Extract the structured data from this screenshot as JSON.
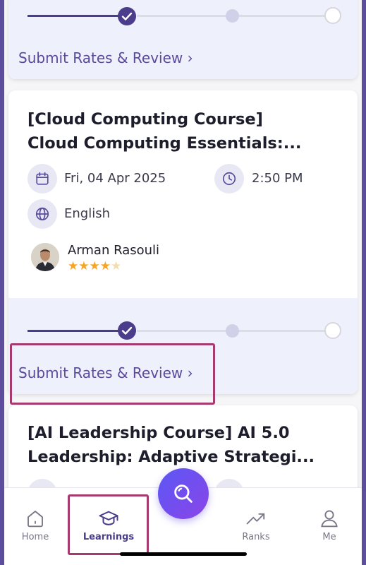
{
  "top_card": {
    "review_link": "Submit Rates & Review"
  },
  "course_card": {
    "title_line1": "[Cloud Computing Course]",
    "title_line2": "Cloud Computing Essentials:...",
    "date": "Fri, 04 Apr 2025",
    "time": "2:50 PM",
    "language": "English",
    "instructor": {
      "name": "Arman Rasouli",
      "rating_stars": 4,
      "rating_max": 5
    },
    "review_link": "Submit Rates & Review"
  },
  "next_card": {
    "title_line1": "[AI Leadership Course] AI 5.0",
    "title_line2": "Leadership: Adaptive Strategi..."
  },
  "bottom_nav": {
    "items": [
      {
        "label": "Home",
        "icon": "home-icon"
      },
      {
        "label": "Learnings",
        "icon": "graduation-cap-icon",
        "active": true
      },
      {
        "label": "Ranks",
        "icon": "trending-up-icon"
      },
      {
        "label": "Me",
        "icon": "user-icon"
      }
    ],
    "fab_icon": "search-icon"
  },
  "colors": {
    "accent": "#5a4a9b",
    "progress_done": "#4b3c8c",
    "progress_pending": "#dcdce4",
    "highlight": "#a63a6e",
    "star": "#f5a524",
    "fab_gradient_start": "#5b57f5",
    "fab_gradient_end": "#8b45e8"
  }
}
